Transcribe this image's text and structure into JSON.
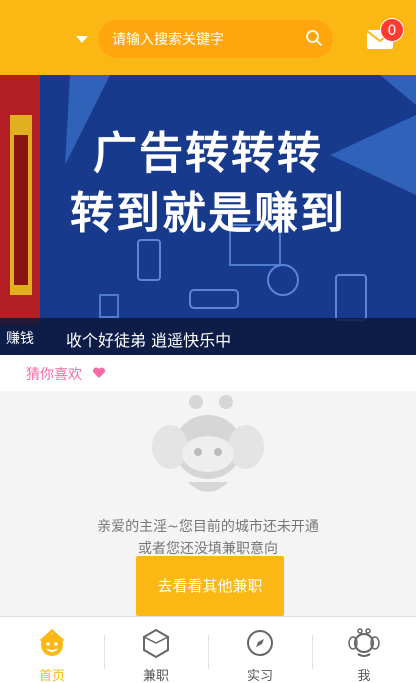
{
  "header": {
    "search_placeholder": "请输入搜索关键字",
    "message_count": "0"
  },
  "banner": {
    "title_line1": "广告转转转",
    "title_line2": "转到就是赚到",
    "ticker_left": "赚钱",
    "ticker_text": "收个好徒弟 逍遥快乐中"
  },
  "section": {
    "title": "猜你喜欢"
  },
  "empty": {
    "line1": "亲爱的主淫~您目前的城市还未开通",
    "line2": "或者您还没填兼职意向",
    "button": "去看看其他兼职"
  },
  "tabs": [
    {
      "label": "首页",
      "icon": "home-smiley-icon",
      "active": true
    },
    {
      "label": "兼职",
      "icon": "hexagon-icon",
      "active": false
    },
    {
      "label": "实习",
      "icon": "compass-icon",
      "active": false
    },
    {
      "label": "我",
      "icon": "bee-profile-icon",
      "active": false
    }
  ],
  "colors": {
    "primary": "#fbb814",
    "badge": "#ff3b30",
    "accent_pink": "#f76aa5"
  }
}
